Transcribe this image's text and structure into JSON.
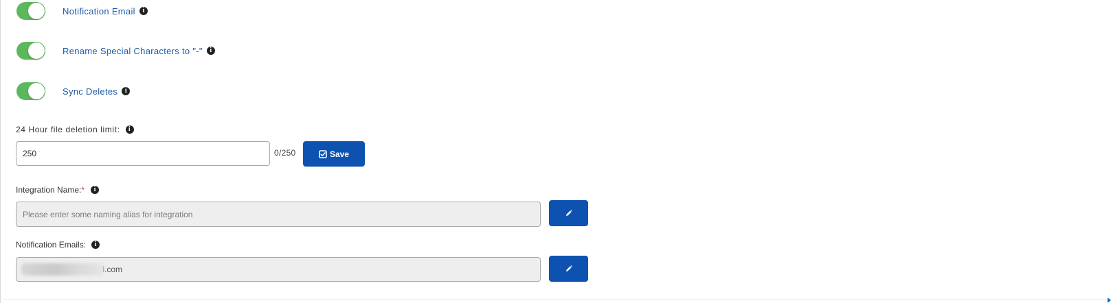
{
  "toggles": [
    {
      "label": "Notification Email",
      "enabled": true
    },
    {
      "label": "Rename Special Characters to \"-\"",
      "enabled": true
    },
    {
      "label": "Sync Deletes",
      "enabled": true
    }
  ],
  "deletion_limit": {
    "label": "24 Hour file deletion limit:",
    "value": "250",
    "counter": "0/250",
    "save_label": "Save"
  },
  "integration_name": {
    "label": "Integration Name:",
    "required_mark": "*",
    "value": "",
    "placeholder": "Please enter some naming alias for integration"
  },
  "notification_emails": {
    "label": "Notification Emails:",
    "value": "mail.com"
  },
  "icons": {
    "info": "info-circle-icon",
    "save": "check-square-icon",
    "edit": "pencil-icon"
  },
  "colors": {
    "toggle_on": "#5cb85c",
    "label_link": "#1e5aa8",
    "primary_button": "#0d52b1",
    "required": "#d9342b",
    "readonly_input_bg": "#eeeeee"
  }
}
